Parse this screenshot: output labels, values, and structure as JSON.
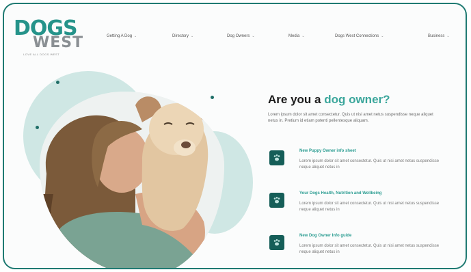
{
  "brand": {
    "logo_top": "DOGS",
    "logo_bottom": "WEST",
    "tagline": "LOVE ALL DOGS WEST"
  },
  "nav": {
    "items": [
      {
        "label": "Getting A Dog"
      },
      {
        "label": "Directory"
      },
      {
        "label": "Dog Owners"
      },
      {
        "label": "Media"
      },
      {
        "label": "Dogs West Connections"
      },
      {
        "label": "Business"
      }
    ]
  },
  "hero": {
    "heading_main": "Are you a ",
    "heading_accent": "dog owner?",
    "intro": "Lorem ipsum dolor sit amet consectetur. Quis ut nisi amet netus suspendisse neque aliquet netus in. Pretium id etiam potenti pellentesque aliquam.",
    "features": [
      {
        "title": "New Puppy Owner info sheet",
        "desc": "Lorem ipsum dolor sit amet consectetur. Quis ut nisi amet netus suspendisse neque aliquet netus in",
        "icon": "paw-icon"
      },
      {
        "title": "Your Dogs Health, Nutrition and Wellbeing",
        "desc": "Lorem ipsum dolor sit amet consectetur. Quis ut nisi amet netus suspendisse neque aliquet netus in",
        "icon": "paw-icon"
      },
      {
        "title": "New Dog Owner Info guide",
        "desc": "Lorem ipsum dolor sit amet consectetur. Quis ut nisi amet netus suspendisse neque aliquet netus in",
        "icon": "paw-icon"
      }
    ]
  },
  "colors": {
    "accent": "#3aa69b",
    "dark_teal": "#155e58",
    "light_teal": "#cfe7e4",
    "border": "#1f7a72"
  }
}
